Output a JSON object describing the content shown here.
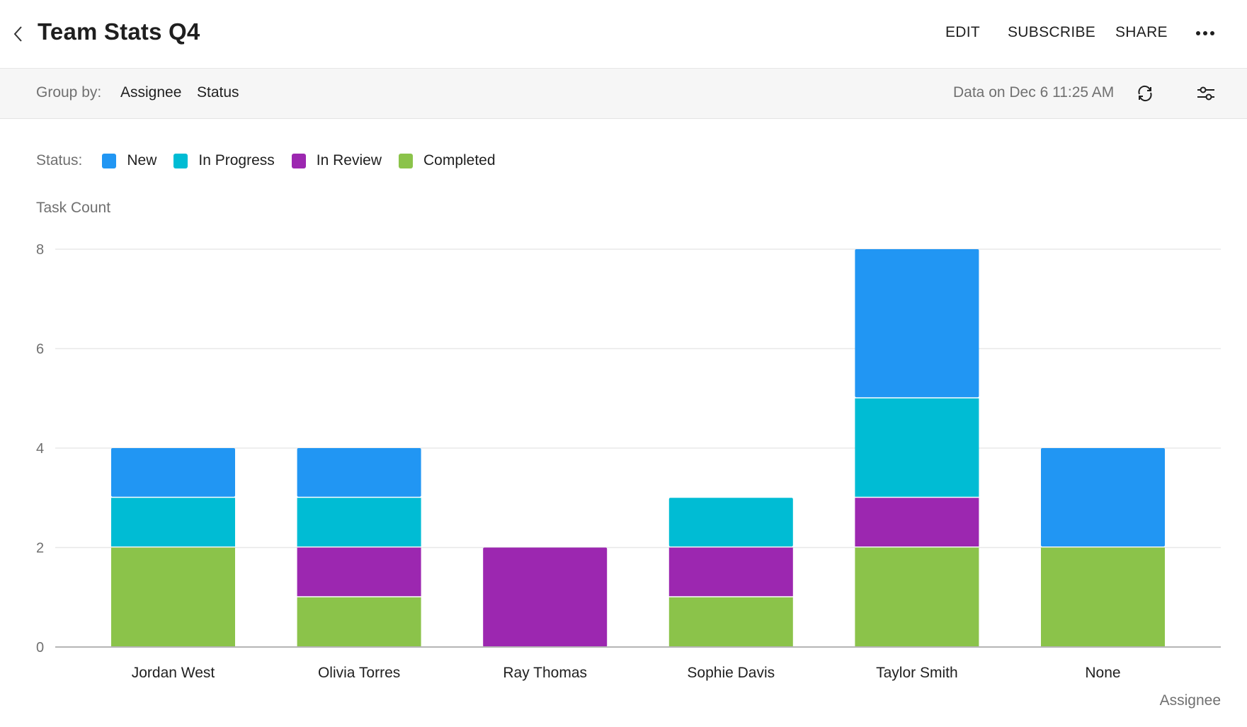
{
  "header": {
    "title": "Team Stats Q4",
    "back_icon": "chevron-left-icon",
    "actions": [
      "EDIT",
      "SUBSCRIBE",
      "SHARE"
    ],
    "more_icon": "more-horizontal-icon"
  },
  "toolbar": {
    "group_by_label": "Group by:",
    "group_by": [
      "Assignee",
      "Status"
    ],
    "data_timestamp": "Data on Dec 6 11:25 AM",
    "refresh_icon": "refresh-icon",
    "filter_icon": "sliders-icon"
  },
  "legend": {
    "label": "Status:",
    "items": [
      {
        "name": "New",
        "color": "#2196f3"
      },
      {
        "name": "In Progress",
        "color": "#00bcd4"
      },
      {
        "name": "In Review",
        "color": "#9c27b0"
      },
      {
        "name": "Completed",
        "color": "#8bc34a"
      }
    ]
  },
  "chart_data": {
    "type": "bar",
    "stacked": true,
    "title": "Team Stats Q4",
    "xlabel": "Assignee",
    "ylabel": "Task Count",
    "ylim": [
      0,
      8
    ],
    "yticks": [
      "0",
      "2",
      "4",
      "6",
      "8"
    ],
    "grid": true,
    "legend_position": "top-left",
    "categories": [
      "Jordan West",
      "Olivia Torres",
      "Ray Thomas",
      "Sophie Davis",
      "Taylor Smith",
      "None"
    ],
    "series": [
      {
        "name": "Completed",
        "color": "#8bc34a",
        "values": [
          2,
          1,
          0,
          1,
          2,
          2
        ]
      },
      {
        "name": "In Review",
        "color": "#9c27b0",
        "values": [
          0,
          1,
          2,
          1,
          1,
          0
        ]
      },
      {
        "name": "In Progress",
        "color": "#00bcd4",
        "values": [
          1,
          1,
          0,
          1,
          2,
          0
        ]
      },
      {
        "name": "New",
        "color": "#2196f3",
        "values": [
          1,
          1,
          0,
          0,
          3,
          2
        ]
      }
    ]
  }
}
